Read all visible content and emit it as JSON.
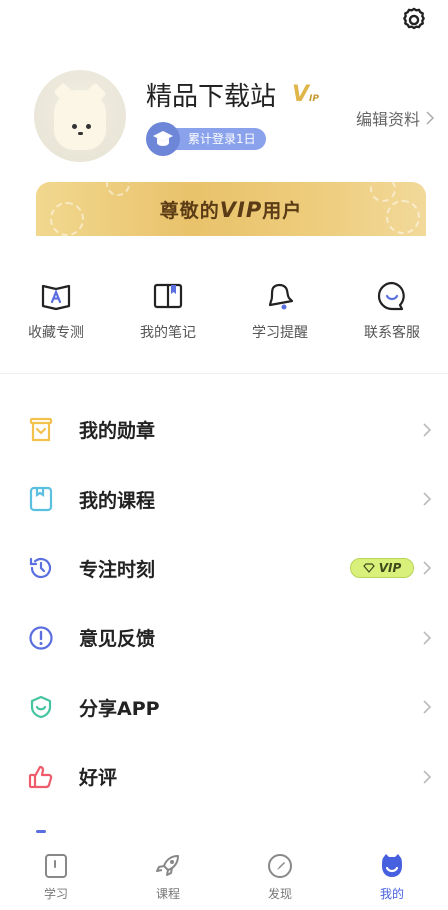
{
  "header": {
    "settings_icon": "gear-icon"
  },
  "profile": {
    "username": "精品下载站",
    "vip_mark": "V",
    "vip_mark_small": "IP",
    "login_badge": "累计登录1日",
    "edit_label": "编辑资料"
  },
  "vip_banner": {
    "prefix": "尊敬的",
    "vip": "VIP",
    "suffix": "用户"
  },
  "quick_actions": [
    {
      "label": "收藏专测",
      "icon": "book-a-icon"
    },
    {
      "label": "我的笔记",
      "icon": "notebook-icon"
    },
    {
      "label": "学习提醒",
      "icon": "bell-icon"
    },
    {
      "label": "联系客服",
      "icon": "chat-smile-icon"
    }
  ],
  "menu": [
    {
      "label": "我的勋章",
      "icon": "medal-icon",
      "color": "#f2c14e"
    },
    {
      "label": "我的课程",
      "icon": "course-icon",
      "color": "#5bc0e0"
    },
    {
      "label": "专注时刻",
      "icon": "clock-rotate-icon",
      "color": "#5b6fe0",
      "badge": "VIP"
    },
    {
      "label": "意见反馈",
      "icon": "exclamation-icon",
      "color": "#5b6fe0"
    },
    {
      "label": "分享APP",
      "icon": "share-smile-icon",
      "color": "#45c4a0"
    },
    {
      "label": "好评",
      "icon": "thumbs-up-icon",
      "color": "#ef5b6b"
    }
  ],
  "tabbar": [
    {
      "label": "学习",
      "icon": "study-icon",
      "active": false
    },
    {
      "label": "课程",
      "icon": "rocket-icon",
      "active": false
    },
    {
      "label": "发现",
      "icon": "compass-icon",
      "active": false
    },
    {
      "label": "我的",
      "icon": "profile-icon",
      "active": true
    }
  ],
  "colors": {
    "accent": "#4760e0",
    "vip_gold": "#e9c26b",
    "vip_tag": "#d9f07a"
  }
}
